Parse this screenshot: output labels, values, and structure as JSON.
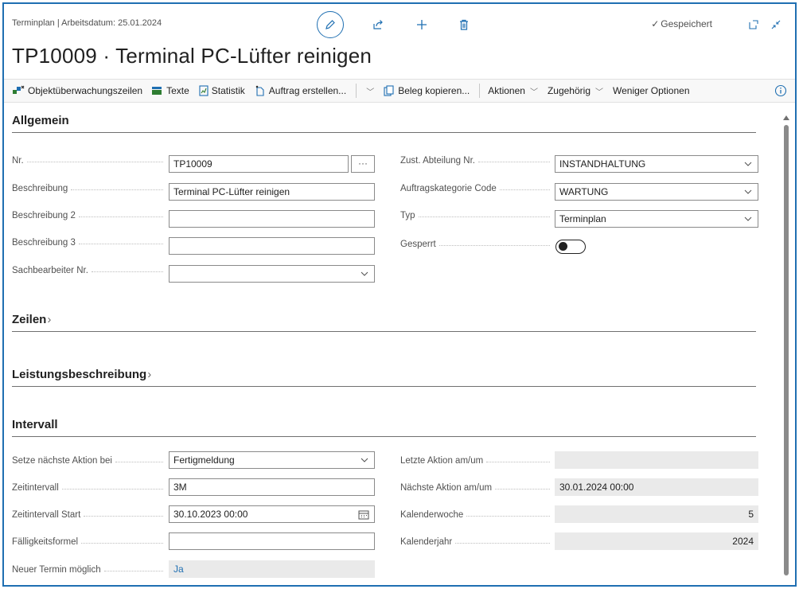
{
  "header": {
    "breadcrumb": "Terminplan | Arbeitsdatum: 25.01.2024",
    "saved_status": "Gespeichert",
    "title": "TP10009 · Terminal PC-Lüfter reinigen"
  },
  "actions": {
    "objektueberwachung": "Objektüberwachungszeilen",
    "texte": "Texte",
    "statistik": "Statistik",
    "auftrag_erstellen": "Auftrag erstellen...",
    "beleg_kopieren": "Beleg kopieren...",
    "aktionen": "Aktionen",
    "zugehoerig": "Zugehörig",
    "weniger_optionen": "Weniger Optionen"
  },
  "allgemein": {
    "heading": "Allgemein",
    "nr_label": "Nr.",
    "nr_value": "TP10009",
    "more_button": "···",
    "beschreibung_label": "Beschreibung",
    "beschreibung_value": "Terminal PC-Lüfter reinigen",
    "beschreibung2_label": "Beschreibung 2",
    "beschreibung2_value": "",
    "beschreibung3_label": "Beschreibung 3",
    "beschreibung3_value": "",
    "sachbearbeiter_label": "Sachbearbeiter Nr.",
    "sachbearbeiter_value": "",
    "abteilung_label": "Zust. Abteilung Nr.",
    "abteilung_value": "INSTANDHALTUNG",
    "kategorie_label": "Auftragskategorie Code",
    "kategorie_value": "WARTUNG",
    "typ_label": "Typ",
    "typ_value": "Terminplan",
    "gesperrt_label": "Gesperrt"
  },
  "zeilen": {
    "heading": "Zeilen",
    "arrow": "›"
  },
  "leistung": {
    "heading": "Leistungsbeschreibung",
    "arrow": "›"
  },
  "intervall": {
    "heading": "Intervall",
    "naechste_bei_label": "Setze nächste Aktion bei",
    "naechste_bei_value": "Fertigmeldung",
    "zeitintervall_label": "Zeitintervall",
    "zeitintervall_value": "3M",
    "start_label": "Zeitintervall Start",
    "start_value": "30.10.2023 00:00",
    "formel_label": "Fälligkeitsformel",
    "formel_value": "",
    "neuer_termin_label": "Neuer Termin möglich",
    "neuer_termin_value": "Ja",
    "letzte_label": "Letzte Aktion am/um",
    "letzte_value": "",
    "naechste_am_label": "Nächste Aktion am/um",
    "naechste_am_value": "30.01.2024 00:00",
    "kw_label": "Kalenderwoche",
    "kw_value": "5",
    "jahr_label": "Kalenderjahr",
    "jahr_value": "2024"
  },
  "colors": {
    "accent": "#1f6fb2",
    "readonly_bg": "#eaeaea"
  }
}
